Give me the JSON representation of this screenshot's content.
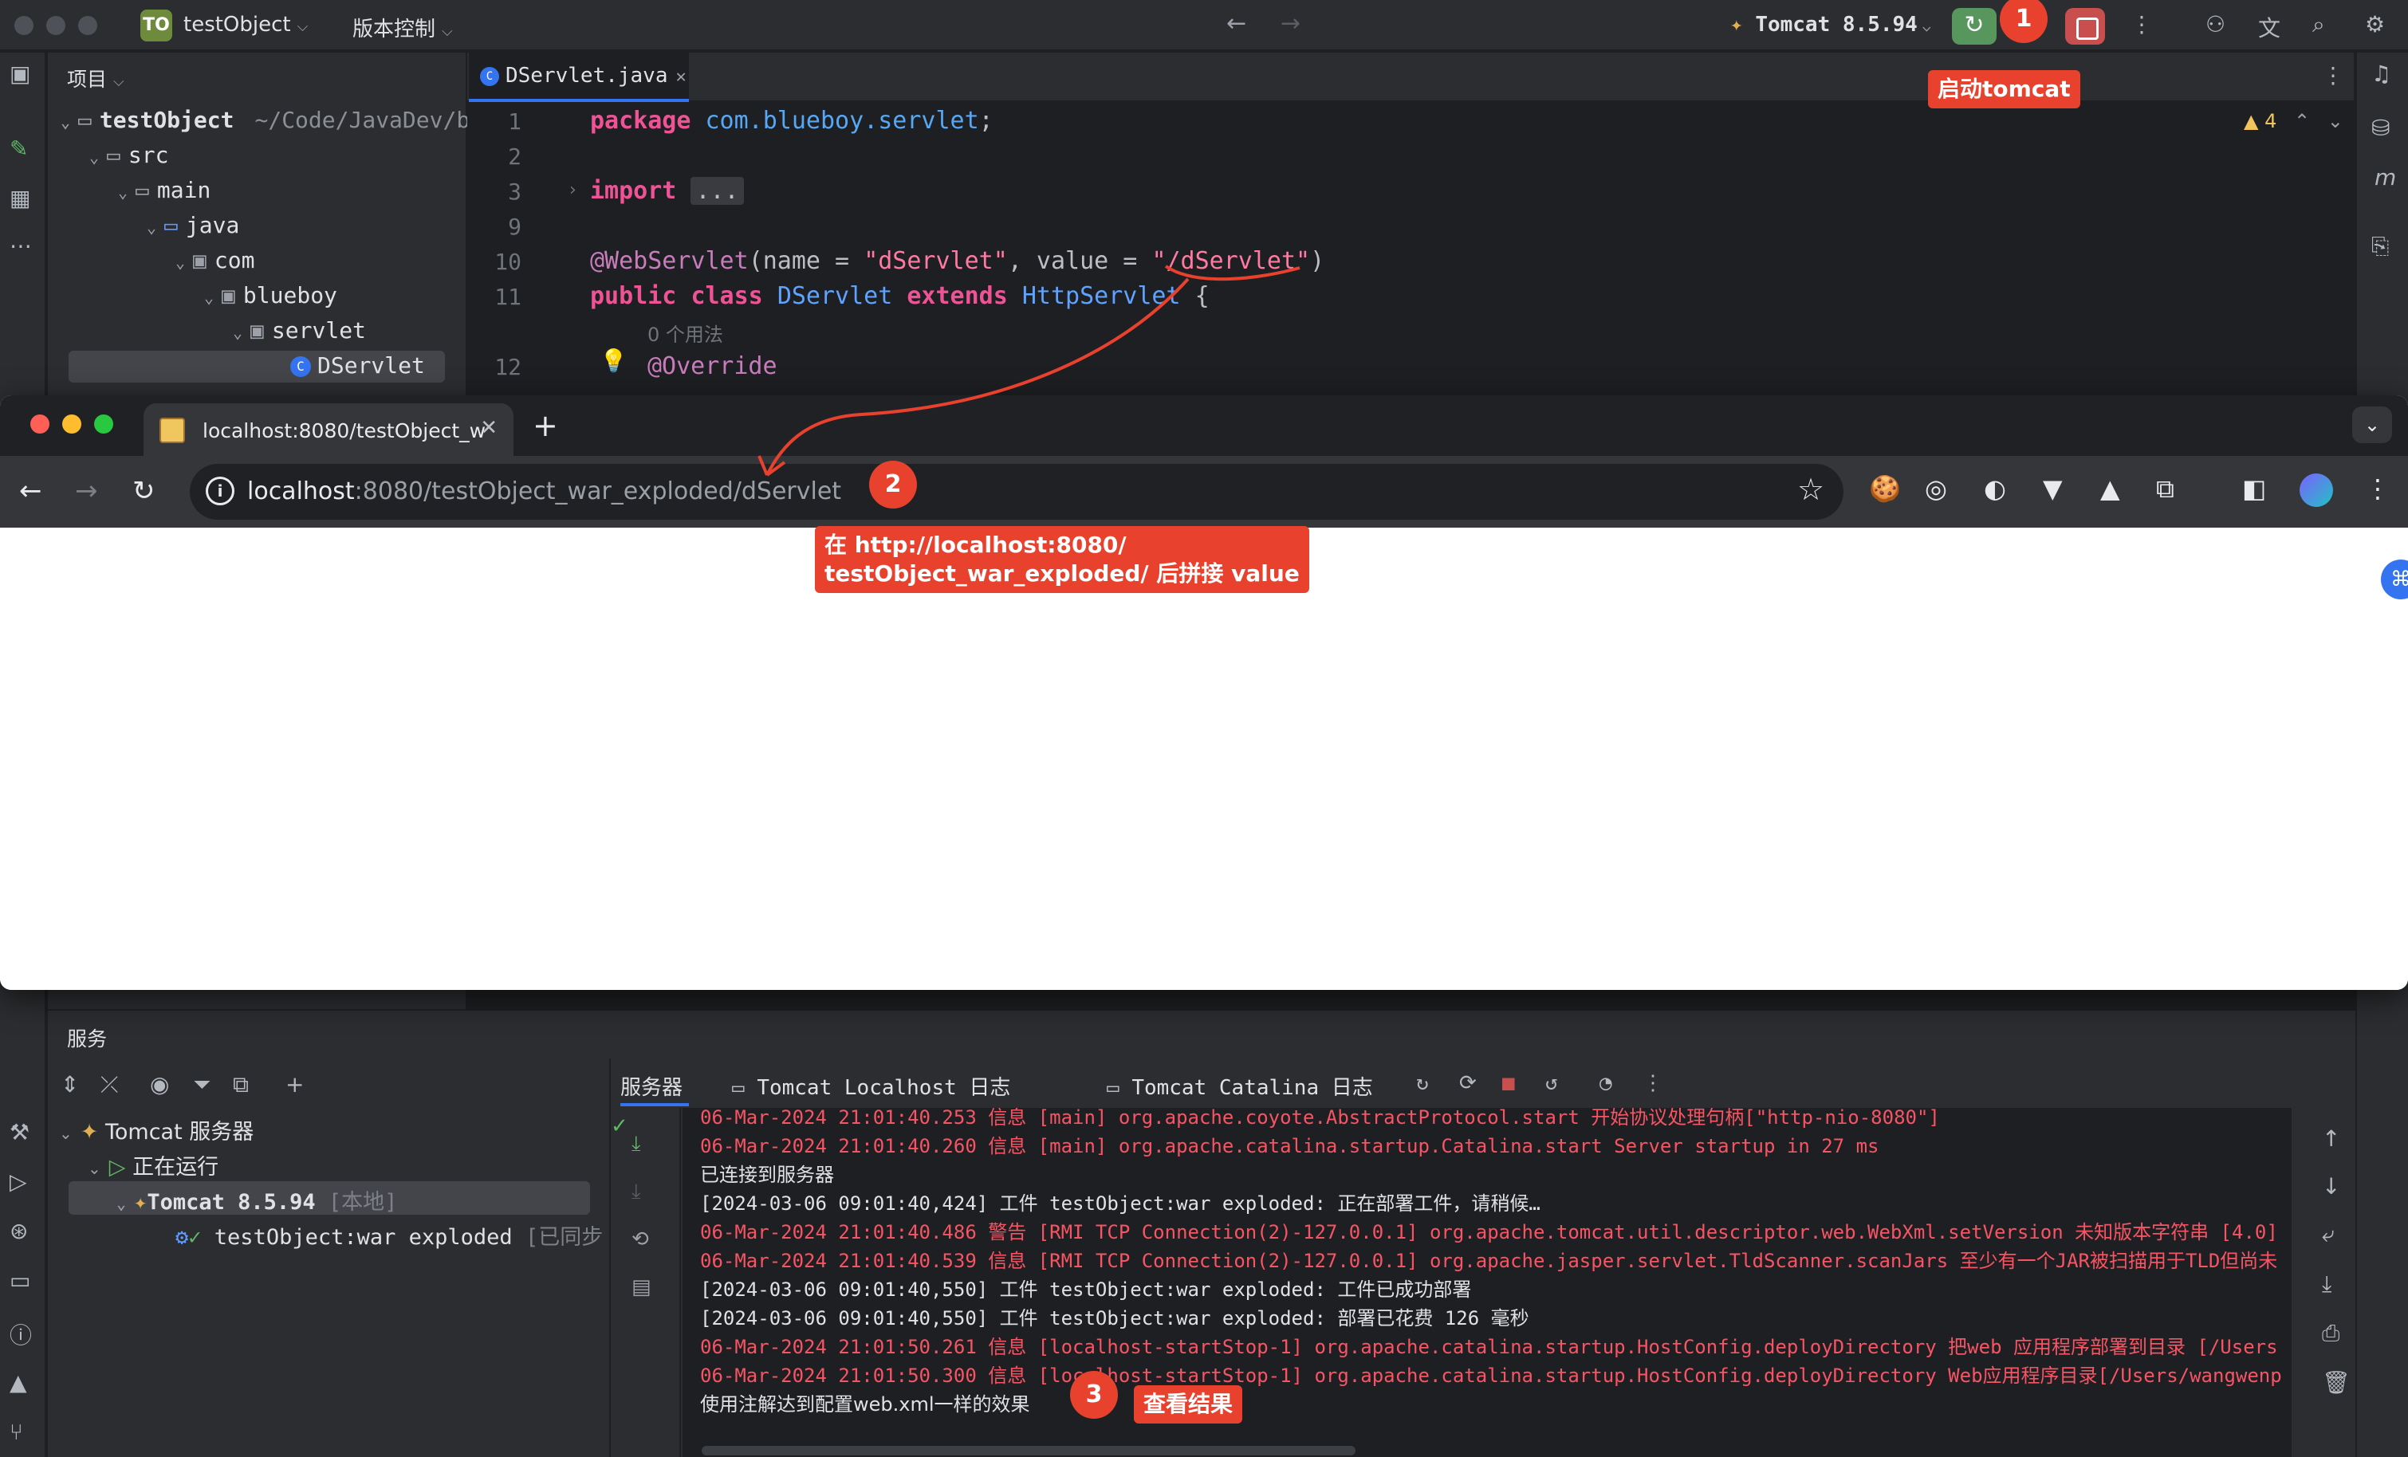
{
  "ide": {
    "project_badge": "TO",
    "project_name": "testObject",
    "vcs_label": "版本控制",
    "run_config": "Tomcat 8.5.94",
    "editor_tab": "DServlet.java",
    "warning_count": "4"
  },
  "project_panel": {
    "title": "项目",
    "tree": {
      "root": "testObject",
      "root_path": "~/Code/JavaDev/b",
      "src": "src",
      "main": "main",
      "java": "java",
      "com": "com",
      "blueboy": "blueboy",
      "servlet": "servlet",
      "dservlet": "DServlet"
    }
  },
  "code": {
    "line_numbers": [
      "1",
      "2",
      "3",
      "9",
      "10",
      "11",
      "12"
    ],
    "l1_kw": "package",
    "l1_pkg": "com.blueboy.servlet",
    "l1_end": ";",
    "l3_kw": "import",
    "l3_fold": "...",
    "l10_ann": "@WebServlet",
    "l10_a": "(name = ",
    "l10_name": "\"dServlet\"",
    "l10_b": ", value = ",
    "l10_value": "\"/dServlet\"",
    "l10_c": ")",
    "l11_public": "public",
    "l11_class": "class",
    "l11_name": "DServlet",
    "l11_extends": "extends",
    "l11_parent": "HttpServlet",
    "l11_brace": " {",
    "usage_hint": "0 个用法",
    "l12_ann": "@Override"
  },
  "browser": {
    "tab_title": "localhost:8080/testObject_w",
    "url_host": "localhost",
    "url_rest": ":8080/testObject_war_exploded/dServlet"
  },
  "services": {
    "title": "服务",
    "tree": {
      "tomcat_server": "Tomcat 服务器",
      "running": "正在运行",
      "tomcat_instance": "Tomcat 8.5.94",
      "local_tag": "[本地]",
      "artifact": "testObject:war exploded",
      "synced_tag": "[已同步"
    },
    "tabs": {
      "server": "服务器",
      "localhost_log": "Tomcat Localhost 日志",
      "catalina_log": "Tomcat Catalina 日志"
    },
    "log_lines": [
      "06-Mar-2024 21:01:40.253 信息 [main] org.apache.coyote.AbstractProtocol.start 开始协议处理句柄[\"http-nio-8080\"]",
      "06-Mar-2024 21:01:40.260 信息 [main] org.apache.catalina.startup.Catalina.start Server startup in 27 ms",
      "已连接到服务器",
      "[2024-03-06 09:01:40,424] 工件 testObject:war exploded: 正在部署工件，请稍候…",
      "06-Mar-2024 21:01:40.486 警告 [RMI TCP Connection(2)-127.0.0.1] org.apache.tomcat.util.descriptor.web.WebXml.setVersion 未知版本字符串 [4.0]",
      "06-Mar-2024 21:01:40.539 信息 [RMI TCP Connection(2)-127.0.0.1] org.apache.jasper.servlet.TldScanner.scanJars 至少有一个JAR被扫描用于TLD但尚未",
      "[2024-03-06 09:01:40,550] 工件 testObject:war exploded: 工件已成功部署",
      "[2024-03-06 09:01:40,550] 工件 testObject:war exploded: 部署已花费 126 毫秒",
      "06-Mar-2024 21:01:50.261 信息 [localhost-startStop-1] org.apache.catalina.startup.HostConfig.deployDirectory 把web 应用程序部署到目录 [/Users",
      "06-Mar-2024 21:01:50.300 信息 [localhost-startStop-1] org.apache.catalina.startup.HostConfig.deployDirectory Web应用程序目录[/Users/wangwenp",
      "使用注解达到配置web.xml一样的效果"
    ]
  },
  "annotations": {
    "n1": "1",
    "label1": "启动tomcat",
    "n2": "2",
    "label2_line1": "在 http://localhost:8080/",
    "label2_line2": "testObject_war_exploded/ 后拼接 value",
    "n3": "3",
    "label3": "查看结果"
  },
  "colors": {
    "annotation": "#e8412d",
    "run_green": "#57965c",
    "stop_red": "#c94f4f",
    "log_red": "#f75464"
  }
}
